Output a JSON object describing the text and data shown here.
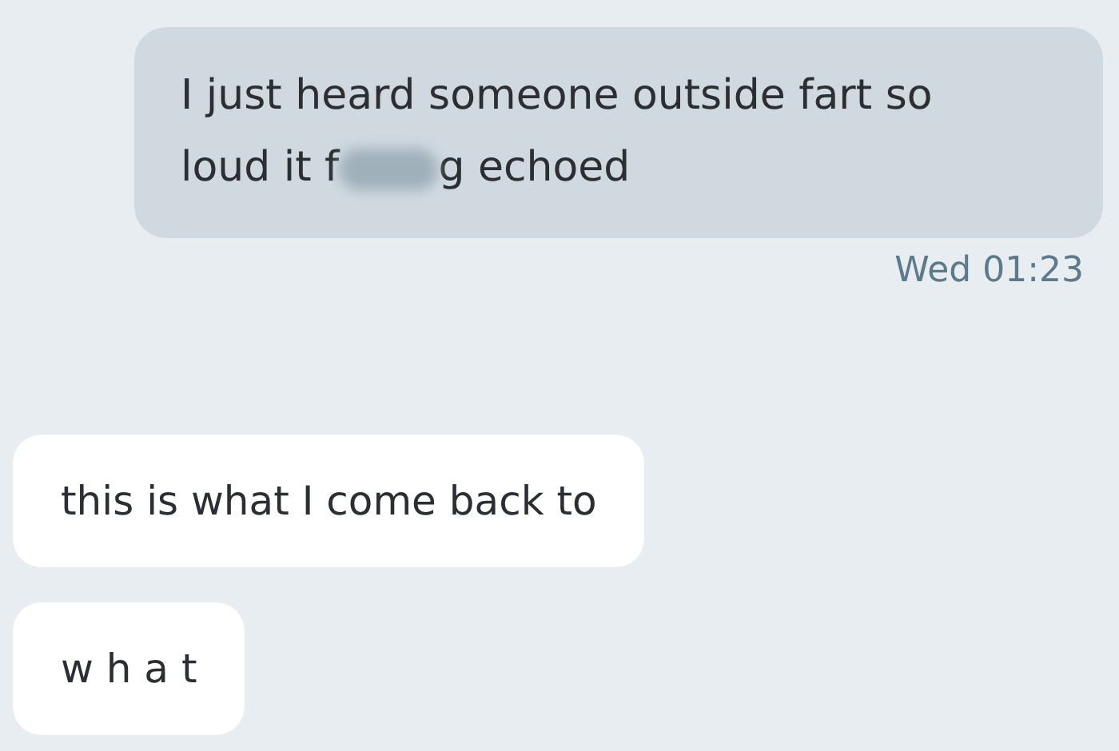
{
  "messages": [
    {
      "kind": "sent",
      "text_before": "I just heard someone outside fart so loud it f",
      "censored": true,
      "text_after": "g echoed",
      "time": "Wed 01:23"
    },
    {
      "kind": "received",
      "text_before": "this is what I come back to"
    },
    {
      "kind": "received",
      "text_before": "w h a t"
    }
  ]
}
